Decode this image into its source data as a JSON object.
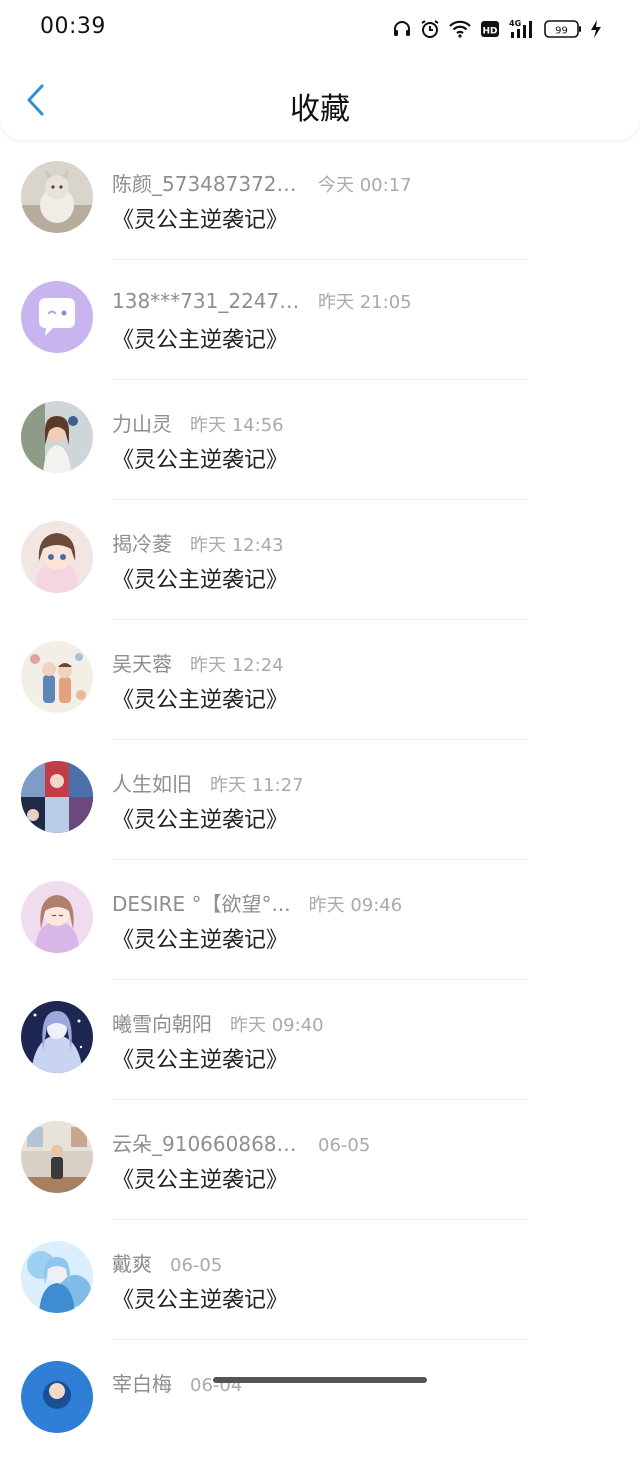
{
  "status_bar": {
    "time": "00:39",
    "battery": "99",
    "network": "4G"
  },
  "header": {
    "title": "收藏",
    "back_icon": "chevron-left-icon"
  },
  "colors": {
    "accent": "#2f8fd8",
    "username": "#8e8e8e",
    "time": "#aaaaaa",
    "title": "#222222"
  },
  "favorites": [
    {
      "username": "陈颜_5734873722...",
      "time": "今天 00:17",
      "book": "《灵公主逆袭记》",
      "avatar": "cat-photo"
    },
    {
      "username": "138***731_22470...",
      "time": "昨天 21:05",
      "book": "《灵公主逆袭记》",
      "avatar": "default-chat-avatar"
    },
    {
      "username": "力山灵",
      "time": "昨天 14:56",
      "book": "《灵公主逆袭记》",
      "avatar": "girl-photo"
    },
    {
      "username": "揭冷菱",
      "time": "昨天 12:43",
      "book": "《灵公主逆袭记》",
      "avatar": "anime-girl"
    },
    {
      "username": "吴天蓉",
      "time": "昨天 12:24",
      "book": "《灵公主逆袭记》",
      "avatar": "couple-illustration"
    },
    {
      "username": "人生如旧",
      "time": "昨天 11:27",
      "book": "《灵公主逆袭记》",
      "avatar": "anime-collage"
    },
    {
      "username": "DESIRE °【欲望°...",
      "time": "昨天 09:46",
      "book": "《灵公主逆袭记》",
      "avatar": "pink-anime-girl"
    },
    {
      "username": "曦雪向朝阳",
      "time": "昨天 09:40",
      "book": "《灵公主逆袭记》",
      "avatar": "blue-anime-girl"
    },
    {
      "username": "云朵_9106608680...",
      "time": "06-05",
      "book": "《灵公主逆袭记》",
      "avatar": "room-photo"
    },
    {
      "username": "戴爽",
      "time": "06-05",
      "book": "《灵公主逆袭记》",
      "avatar": "blue-fairy"
    },
    {
      "username": "宰白梅",
      "time": "06-04",
      "book": "",
      "avatar": "blue-avatar"
    }
  ]
}
